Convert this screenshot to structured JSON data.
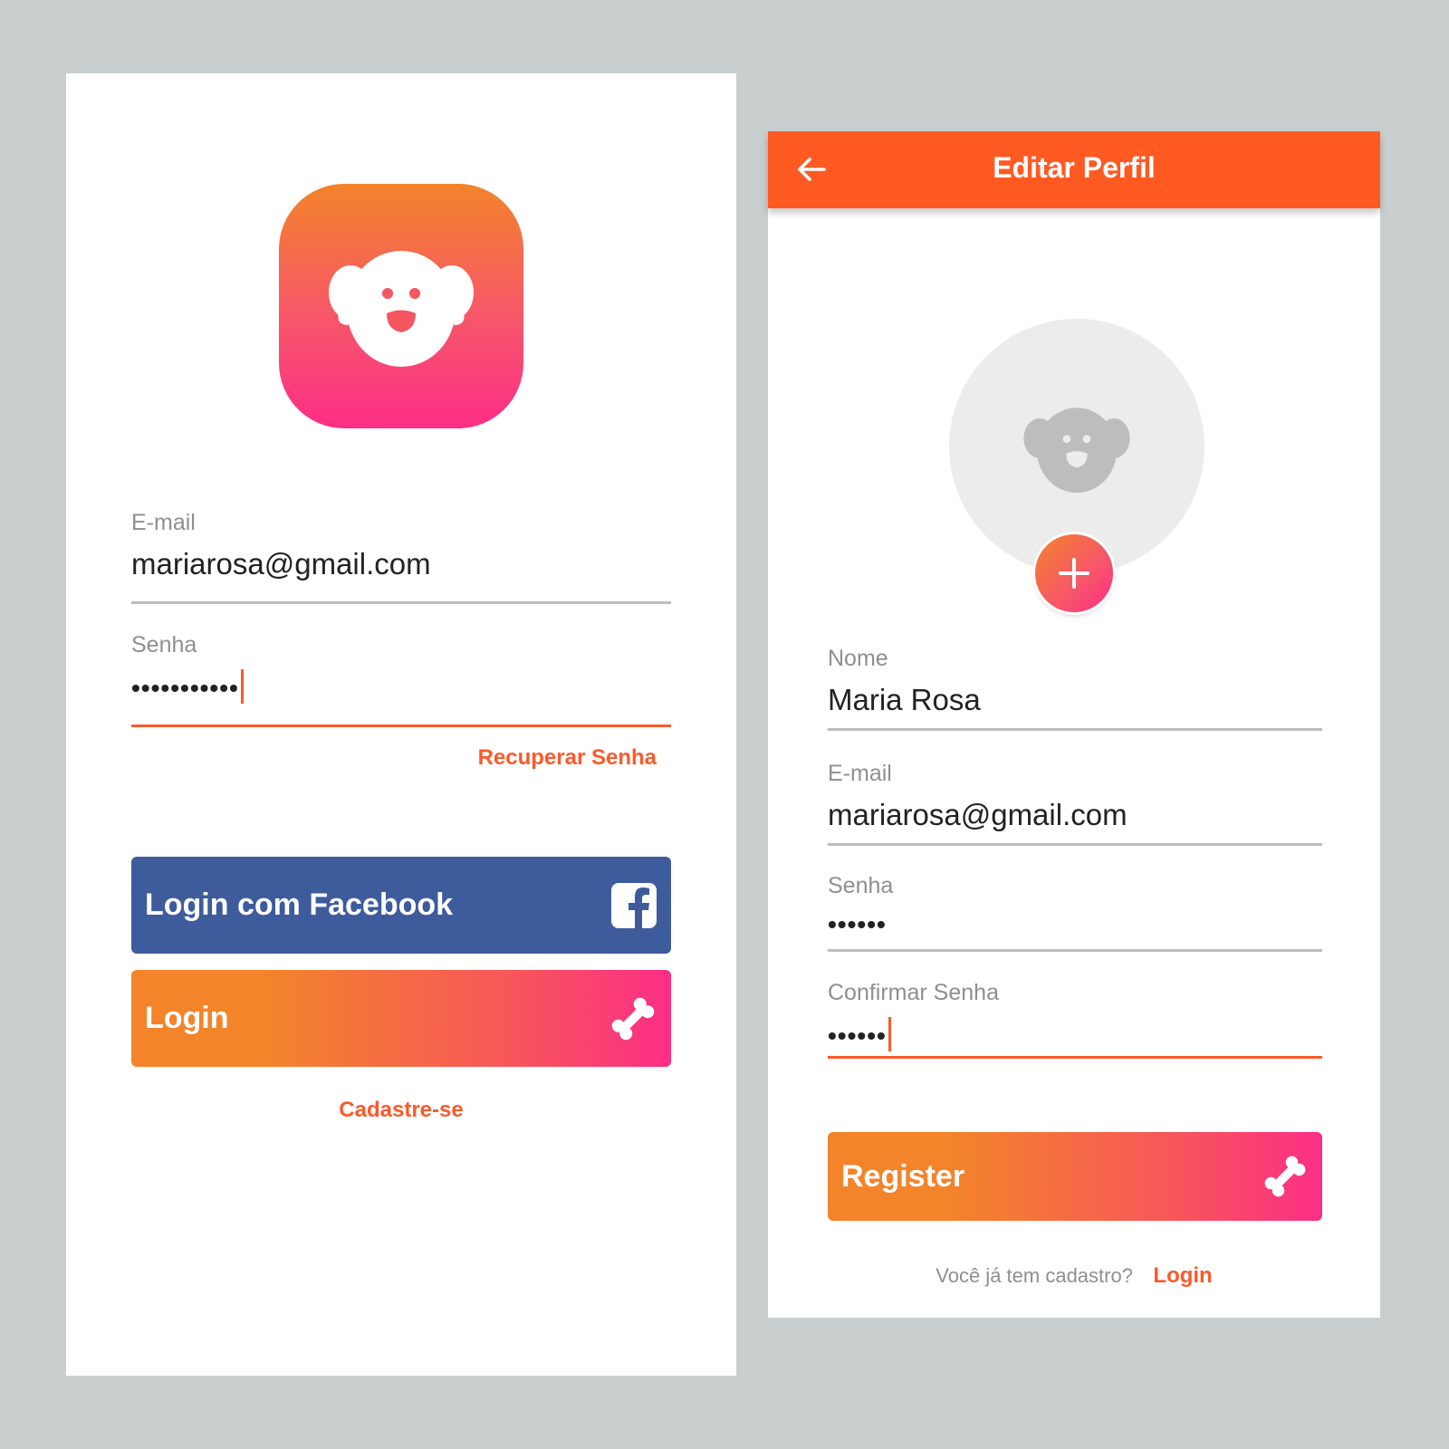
{
  "login": {
    "email_label": "E-mail",
    "email_value": "mariarosa@gmail.com",
    "password_label": "Senha",
    "password_value": "•••••••••••",
    "recover_link": "Recuperar Senha",
    "facebook_button": "Login com Facebook",
    "login_button": "Login",
    "signup_link": "Cadastre-se"
  },
  "profile": {
    "title": "Editar Perfil",
    "name_label": "Nome",
    "name_value": "Maria Rosa",
    "email_label": "E-mail",
    "email_value": "mariarosa@gmail.com",
    "password_label": "Senha",
    "password_value": "••••••",
    "confirm_label": "Confirmar Senha",
    "confirm_value": "••••••",
    "register_button": "Register",
    "have_account_text": "Você já tem cadastro?",
    "login_link": "Login"
  },
  "icons": [
    "dog-logo-icon",
    "facebook-icon",
    "bone-icon",
    "back-arrow-icon",
    "dog-placeholder-icon",
    "plus-icon"
  ],
  "colors": {
    "accent": "#ff5a22",
    "facebook": "#3e5b9c",
    "gradient_start": "#f3842a",
    "gradient_end": "#fc2e86",
    "background": "#c9cfcf"
  }
}
